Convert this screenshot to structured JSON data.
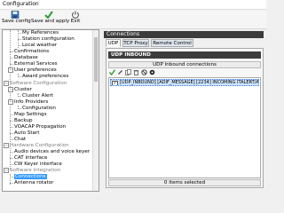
{
  "window": {
    "title": "Configuration"
  },
  "toolbar": {
    "save_config_label": "Save config",
    "save_apply_label": "Save and apply",
    "exit_label": "Exit"
  },
  "tree": {
    "items": [
      {
        "label": "My References"
      },
      {
        "label": "Station configuration"
      },
      {
        "label": "Local weather"
      },
      {
        "label": "Confirmations"
      },
      {
        "label": "Database"
      },
      {
        "label": "External Services"
      },
      {
        "label": "User preferences"
      },
      {
        "label": "Award preferences"
      },
      {
        "label": "Software Configuration"
      },
      {
        "label": "Cluster"
      },
      {
        "label": "Cluster Alert"
      },
      {
        "label": "Info Providers"
      },
      {
        "label": "Configuration"
      },
      {
        "label": "Map Settings"
      },
      {
        "label": "Backup"
      },
      {
        "label": "VOACAP Propagation"
      },
      {
        "label": "Auto Start"
      },
      {
        "label": "Chat"
      },
      {
        "label": "Hardware Configuration"
      },
      {
        "label": "Audio devices and voice keyer"
      },
      {
        "label": "CAT interface"
      },
      {
        "label": "CW Keyer interface"
      },
      {
        "label": "Software integration"
      },
      {
        "label": "Connections"
      },
      {
        "label": "Antenna rotator"
      }
    ]
  },
  "right": {
    "title": "Connections",
    "tabs": [
      {
        "label": "UDP"
      },
      {
        "label": "TCP Proxy"
      },
      {
        "label": "Remote Control"
      }
    ],
    "section_header": "UDP INBOUND",
    "grid_title": "UDP Inbound connections",
    "grid_row": "[UDP_INBOUND] [ADIF_MESSAGE] [2234] INCOMING ITALERT/A",
    "grid_row_checked": "✓",
    "grid_footer": "0 items selected"
  },
  "colors": {
    "selection": "#3399ff",
    "dark_header": "#3c3c3c",
    "add_green": "#2e9e2e"
  }
}
